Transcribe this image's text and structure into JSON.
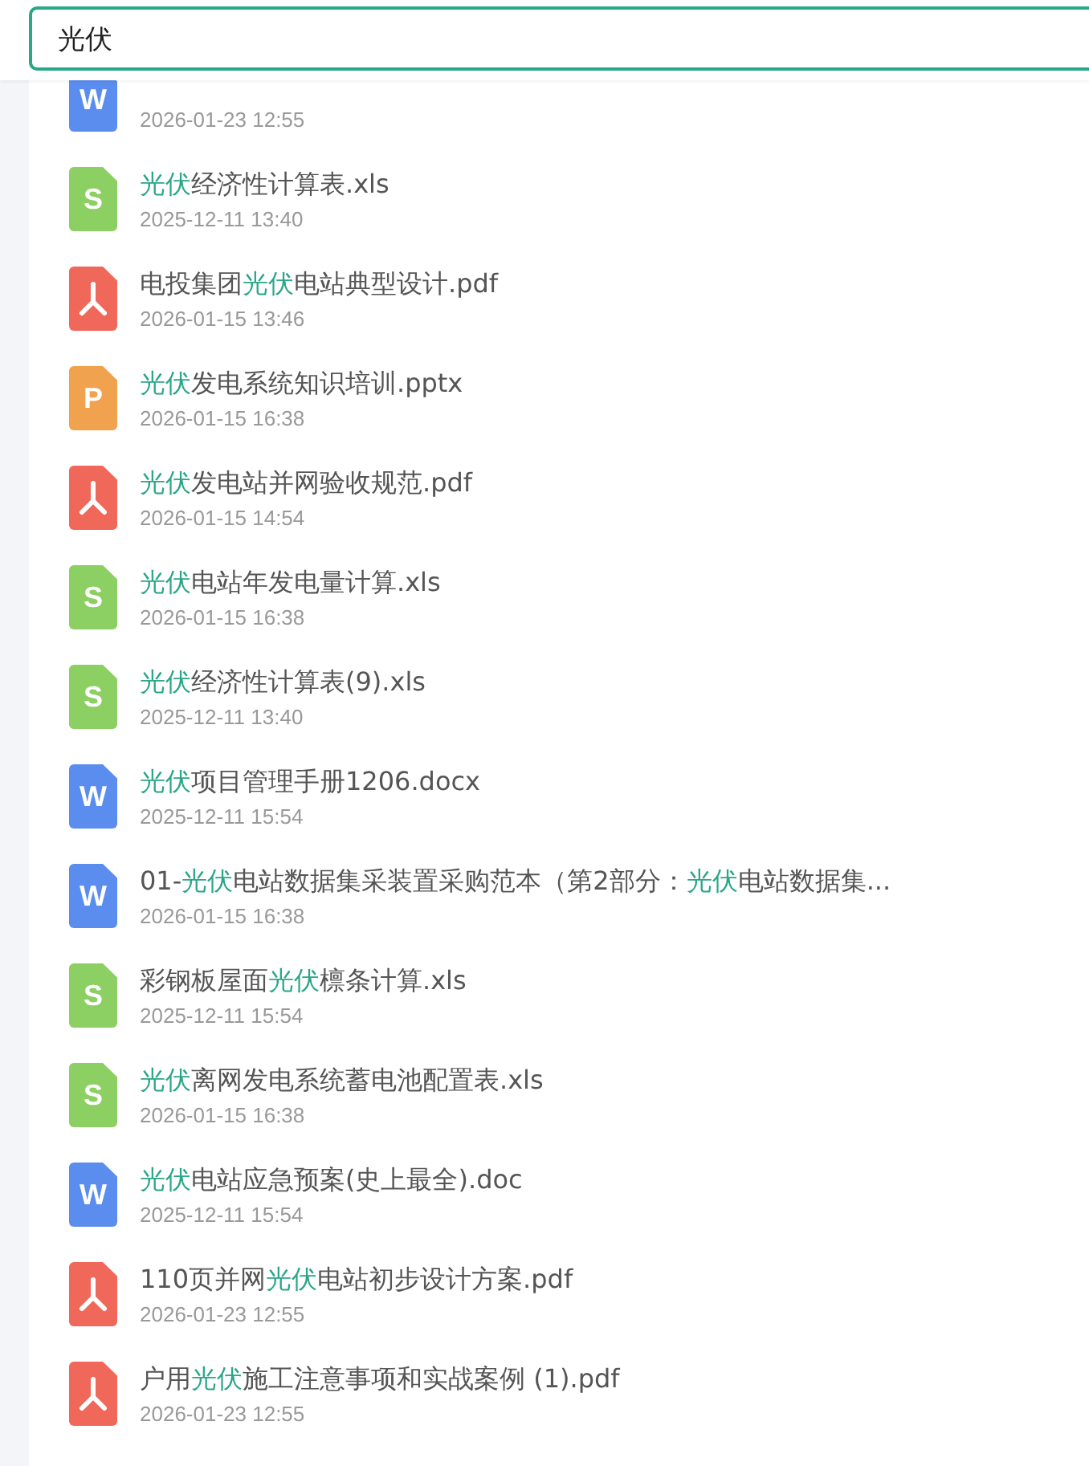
{
  "search": {
    "value": "光伏"
  },
  "files": [
    {
      "kind": "word",
      "letter": "W",
      "date": "2026-01-23 12:55"
    },
    {
      "kind": "excel",
      "letter": "S",
      "name": [
        {
          "text": "光伏",
          "match": true
        },
        {
          "text": "经济性计算表.xls",
          "match": false
        }
      ],
      "date": "2025-12-11 13:40"
    },
    {
      "kind": "pdf",
      "name": [
        {
          "text": "电投集团",
          "match": false
        },
        {
          "text": "光伏",
          "match": true
        },
        {
          "text": "电站典型设计.pdf",
          "match": false
        }
      ],
      "date": "2026-01-15 13:46"
    },
    {
      "kind": "ppt",
      "letter": "P",
      "name": [
        {
          "text": "光伏",
          "match": true
        },
        {
          "text": "发电系统知识培训.pptx",
          "match": false
        }
      ],
      "date": "2026-01-15 16:38"
    },
    {
      "kind": "pdf",
      "name": [
        {
          "text": "光伏",
          "match": true
        },
        {
          "text": "发电站并网验收规范.pdf",
          "match": false
        }
      ],
      "date": "2026-01-15 14:54"
    },
    {
      "kind": "excel",
      "letter": "S",
      "name": [
        {
          "text": "光伏",
          "match": true
        },
        {
          "text": "电站年发电量计算.xls",
          "match": false
        }
      ],
      "date": "2026-01-15 16:38"
    },
    {
      "kind": "excel",
      "letter": "S",
      "name": [
        {
          "text": "光伏",
          "match": true
        },
        {
          "text": "经济性计算表(9).xls",
          "match": false
        }
      ],
      "date": "2025-12-11 13:40"
    },
    {
      "kind": "word",
      "letter": "W",
      "name": [
        {
          "text": "光伏",
          "match": true
        },
        {
          "text": "项目管理手册1206.docx",
          "match": false
        }
      ],
      "date": "2025-12-11 15:54"
    },
    {
      "kind": "word",
      "letter": "W",
      "name": [
        {
          "text": "01-",
          "match": false
        },
        {
          "text": "光伏",
          "match": true
        },
        {
          "text": "电站数据集采装置采购范本（第2部分：",
          "match": false
        },
        {
          "text": "光伏",
          "match": true
        },
        {
          "text": "电站数据集...",
          "match": false
        }
      ],
      "date": "2026-01-15 16:38"
    },
    {
      "kind": "excel",
      "letter": "S",
      "name": [
        {
          "text": "彩钢板屋面",
          "match": false
        },
        {
          "text": "光伏",
          "match": true
        },
        {
          "text": "檩条计算.xls",
          "match": false
        }
      ],
      "date": "2025-12-11 15:54"
    },
    {
      "kind": "excel",
      "letter": "S",
      "name": [
        {
          "text": "光伏",
          "match": true
        },
        {
          "text": "离网发电系统蓄电池配置表.xls",
          "match": false
        }
      ],
      "date": "2026-01-15 16:38"
    },
    {
      "kind": "word",
      "letter": "W",
      "name": [
        {
          "text": "光伏",
          "match": true
        },
        {
          "text": "电站应急预案(史上最全).doc",
          "match": false
        }
      ],
      "date": "2025-12-11 15:54"
    },
    {
      "kind": "pdf",
      "name": [
        {
          "text": "110页并网",
          "match": false
        },
        {
          "text": "光伏",
          "match": true
        },
        {
          "text": "电站初步设计方案.pdf",
          "match": false
        }
      ],
      "date": "2026-01-23 12:55"
    },
    {
      "kind": "pdf",
      "name": [
        {
          "text": "户用",
          "match": false
        },
        {
          "text": "光伏",
          "match": true
        },
        {
          "text": "施工注意事项和实战案例 (1).pdf",
          "match": false
        }
      ],
      "date": "2026-01-23 12:55"
    }
  ]
}
